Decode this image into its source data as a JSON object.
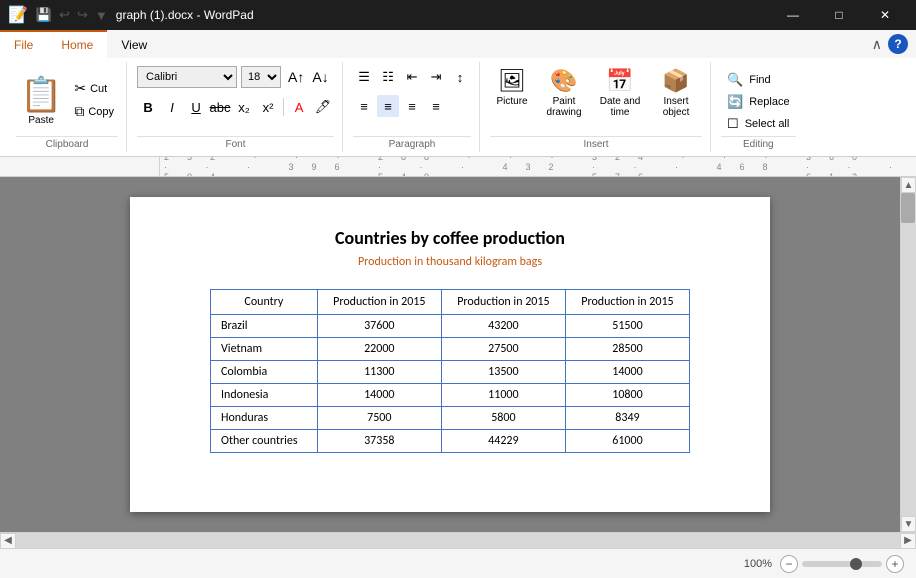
{
  "titlebar": {
    "title": "graph (1).docx - WordPad",
    "quick_access": [
      "💾",
      "↩",
      "↪",
      "▼"
    ],
    "controls": [
      "—",
      "□",
      "✕"
    ]
  },
  "ribbon": {
    "tabs": [
      "File",
      "Home",
      "View"
    ],
    "active_tab": "Home",
    "groups": {
      "clipboard": {
        "label": "Clipboard",
        "paste_label": "Paste",
        "items": [
          {
            "label": "Cut",
            "icon": "✂"
          },
          {
            "label": "Copy",
            "icon": "⧉"
          }
        ]
      },
      "font": {
        "label": "Font",
        "font_name": "Calibri",
        "font_size": "18",
        "format_btns": [
          "B",
          "I",
          "U",
          "abc",
          "x₂",
          "x²",
          "A",
          "🖌"
        ]
      },
      "paragraph": {
        "label": "Paragraph",
        "align_btns": [
          "≡",
          "≡",
          "≡",
          "≡"
        ],
        "list_btns": [
          "☰",
          "☷",
          "⇥",
          "⇥"
        ]
      },
      "insert": {
        "label": "Insert",
        "items": [
          {
            "label": "Picture",
            "icon": "🖼"
          },
          {
            "label": "Paint drawing",
            "icon": "🎨"
          },
          {
            "label": "Date and time",
            "icon": "📅"
          },
          {
            "label": "Insert object",
            "icon": "📦"
          }
        ]
      },
      "editing": {
        "label": "Editing",
        "items": [
          {
            "label": "Find",
            "icon": "🔍"
          },
          {
            "label": "Replace",
            "icon": "🔄"
          },
          {
            "label": "Select all",
            "icon": "☐"
          }
        ]
      }
    }
  },
  "document": {
    "title": "Countries by coffee production",
    "subtitle": "Production in thousand kilogram bags",
    "table": {
      "headers": [
        "Country",
        "Production in 2015",
        "Production in 2015",
        "Production in 2015"
      ],
      "rows": [
        [
          "Brazil",
          "37600",
          "43200",
          "51500"
        ],
        [
          "Vietnam",
          "22000",
          "27500",
          "28500"
        ],
        [
          "Colombia",
          "11300",
          "13500",
          "14000"
        ],
        [
          "Indonesia",
          "14000",
          "11000",
          "10800"
        ],
        [
          "Honduras",
          "7500",
          "5800",
          "8349"
        ],
        [
          "Other countries",
          "37358",
          "44229",
          "61000"
        ]
      ]
    }
  },
  "statusbar": {
    "zoom_level": "100%",
    "zoom_minus": "−",
    "zoom_plus": "+"
  }
}
